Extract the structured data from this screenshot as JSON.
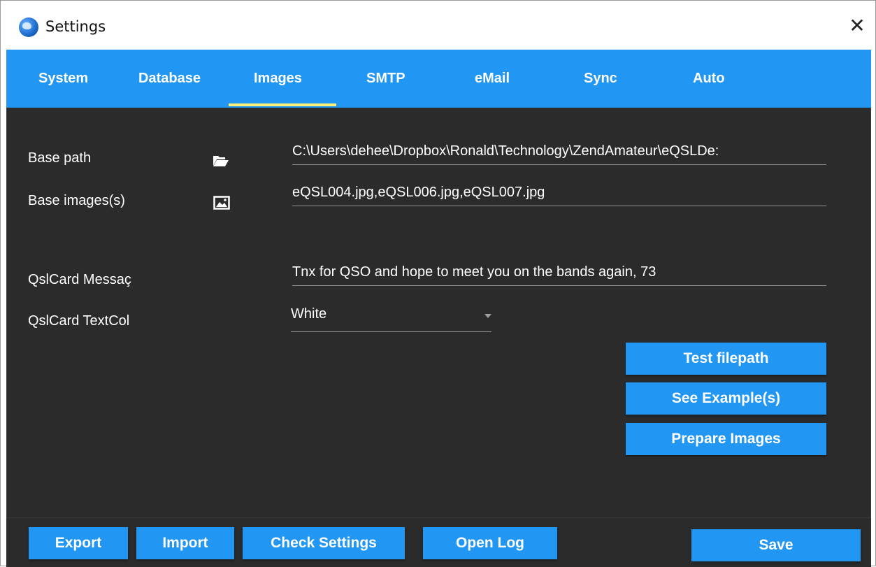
{
  "window": {
    "title": "Settings",
    "close_glyph": "✕"
  },
  "tabs": [
    {
      "label": "System"
    },
    {
      "label": "Database"
    },
    {
      "label": "Images",
      "selected": true
    },
    {
      "label": "SMTP"
    },
    {
      "label": "eMail"
    },
    {
      "label": "Sync"
    },
    {
      "label": "Auto"
    }
  ],
  "images": {
    "base_path": {
      "label": "Base path",
      "value": "C:\\Users\\dehee\\Dropbox\\Ronald\\Technology\\ZendAmateur\\eQSLDe:",
      "icon": "folder-open-icon"
    },
    "base_images": {
      "label": "Base images(s)",
      "value": "eQSL004.jpg,eQSL006.jpg,eQSL007.jpg",
      "icon": "image-icon"
    },
    "qsl_message": {
      "label": "QslCard Messaç",
      "value": "Tnx for QSO and hope to meet you on the bands again, 73"
    },
    "qsl_textcolor": {
      "label": "QslCard TextCol",
      "value": "White"
    },
    "buttons": {
      "test_filepath": "Test filepath",
      "see_examples": "See Example(s)",
      "prepare_images": "Prepare Images"
    }
  },
  "footer": {
    "export": "Export",
    "import": "Import",
    "check_settings": "Check Settings",
    "open_log": "Open Log",
    "save": "Save"
  },
  "colors": {
    "accent": "#2196f3",
    "indicator": "#fff176",
    "background": "#2b2b2b"
  }
}
